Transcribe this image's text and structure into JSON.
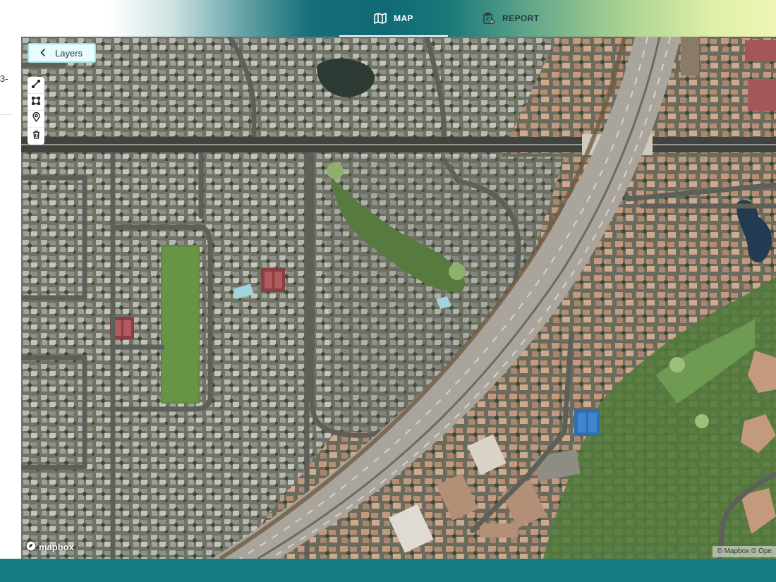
{
  "header": {
    "tabs": [
      {
        "label": "MAP",
        "icon": "map-icon",
        "active": true
      },
      {
        "label": "REPORT",
        "icon": "clipboard-report-icon",
        "active": false
      }
    ]
  },
  "side_panel": {
    "fragment_text": "3-"
  },
  "map": {
    "layers_button": {
      "label": "Layers",
      "icon": "chevron-left-icon"
    },
    "tools": [
      {
        "name": "draw-line-tool",
        "icon": "line-icon"
      },
      {
        "name": "draw-polygon-tool",
        "icon": "polygon-icon"
      },
      {
        "name": "add-marker-tool",
        "icon": "pin-icon"
      },
      {
        "name": "delete-tool",
        "icon": "trash-icon"
      }
    ],
    "logo_text": "mapbox",
    "attribution": "© Mapbox © Ope"
  },
  "colors": {
    "accent": "#177c84",
    "tab_active_text": "#ffffff",
    "tab_inactive_text": "#1f3b3e",
    "layers_border": "#9fe3e6"
  }
}
